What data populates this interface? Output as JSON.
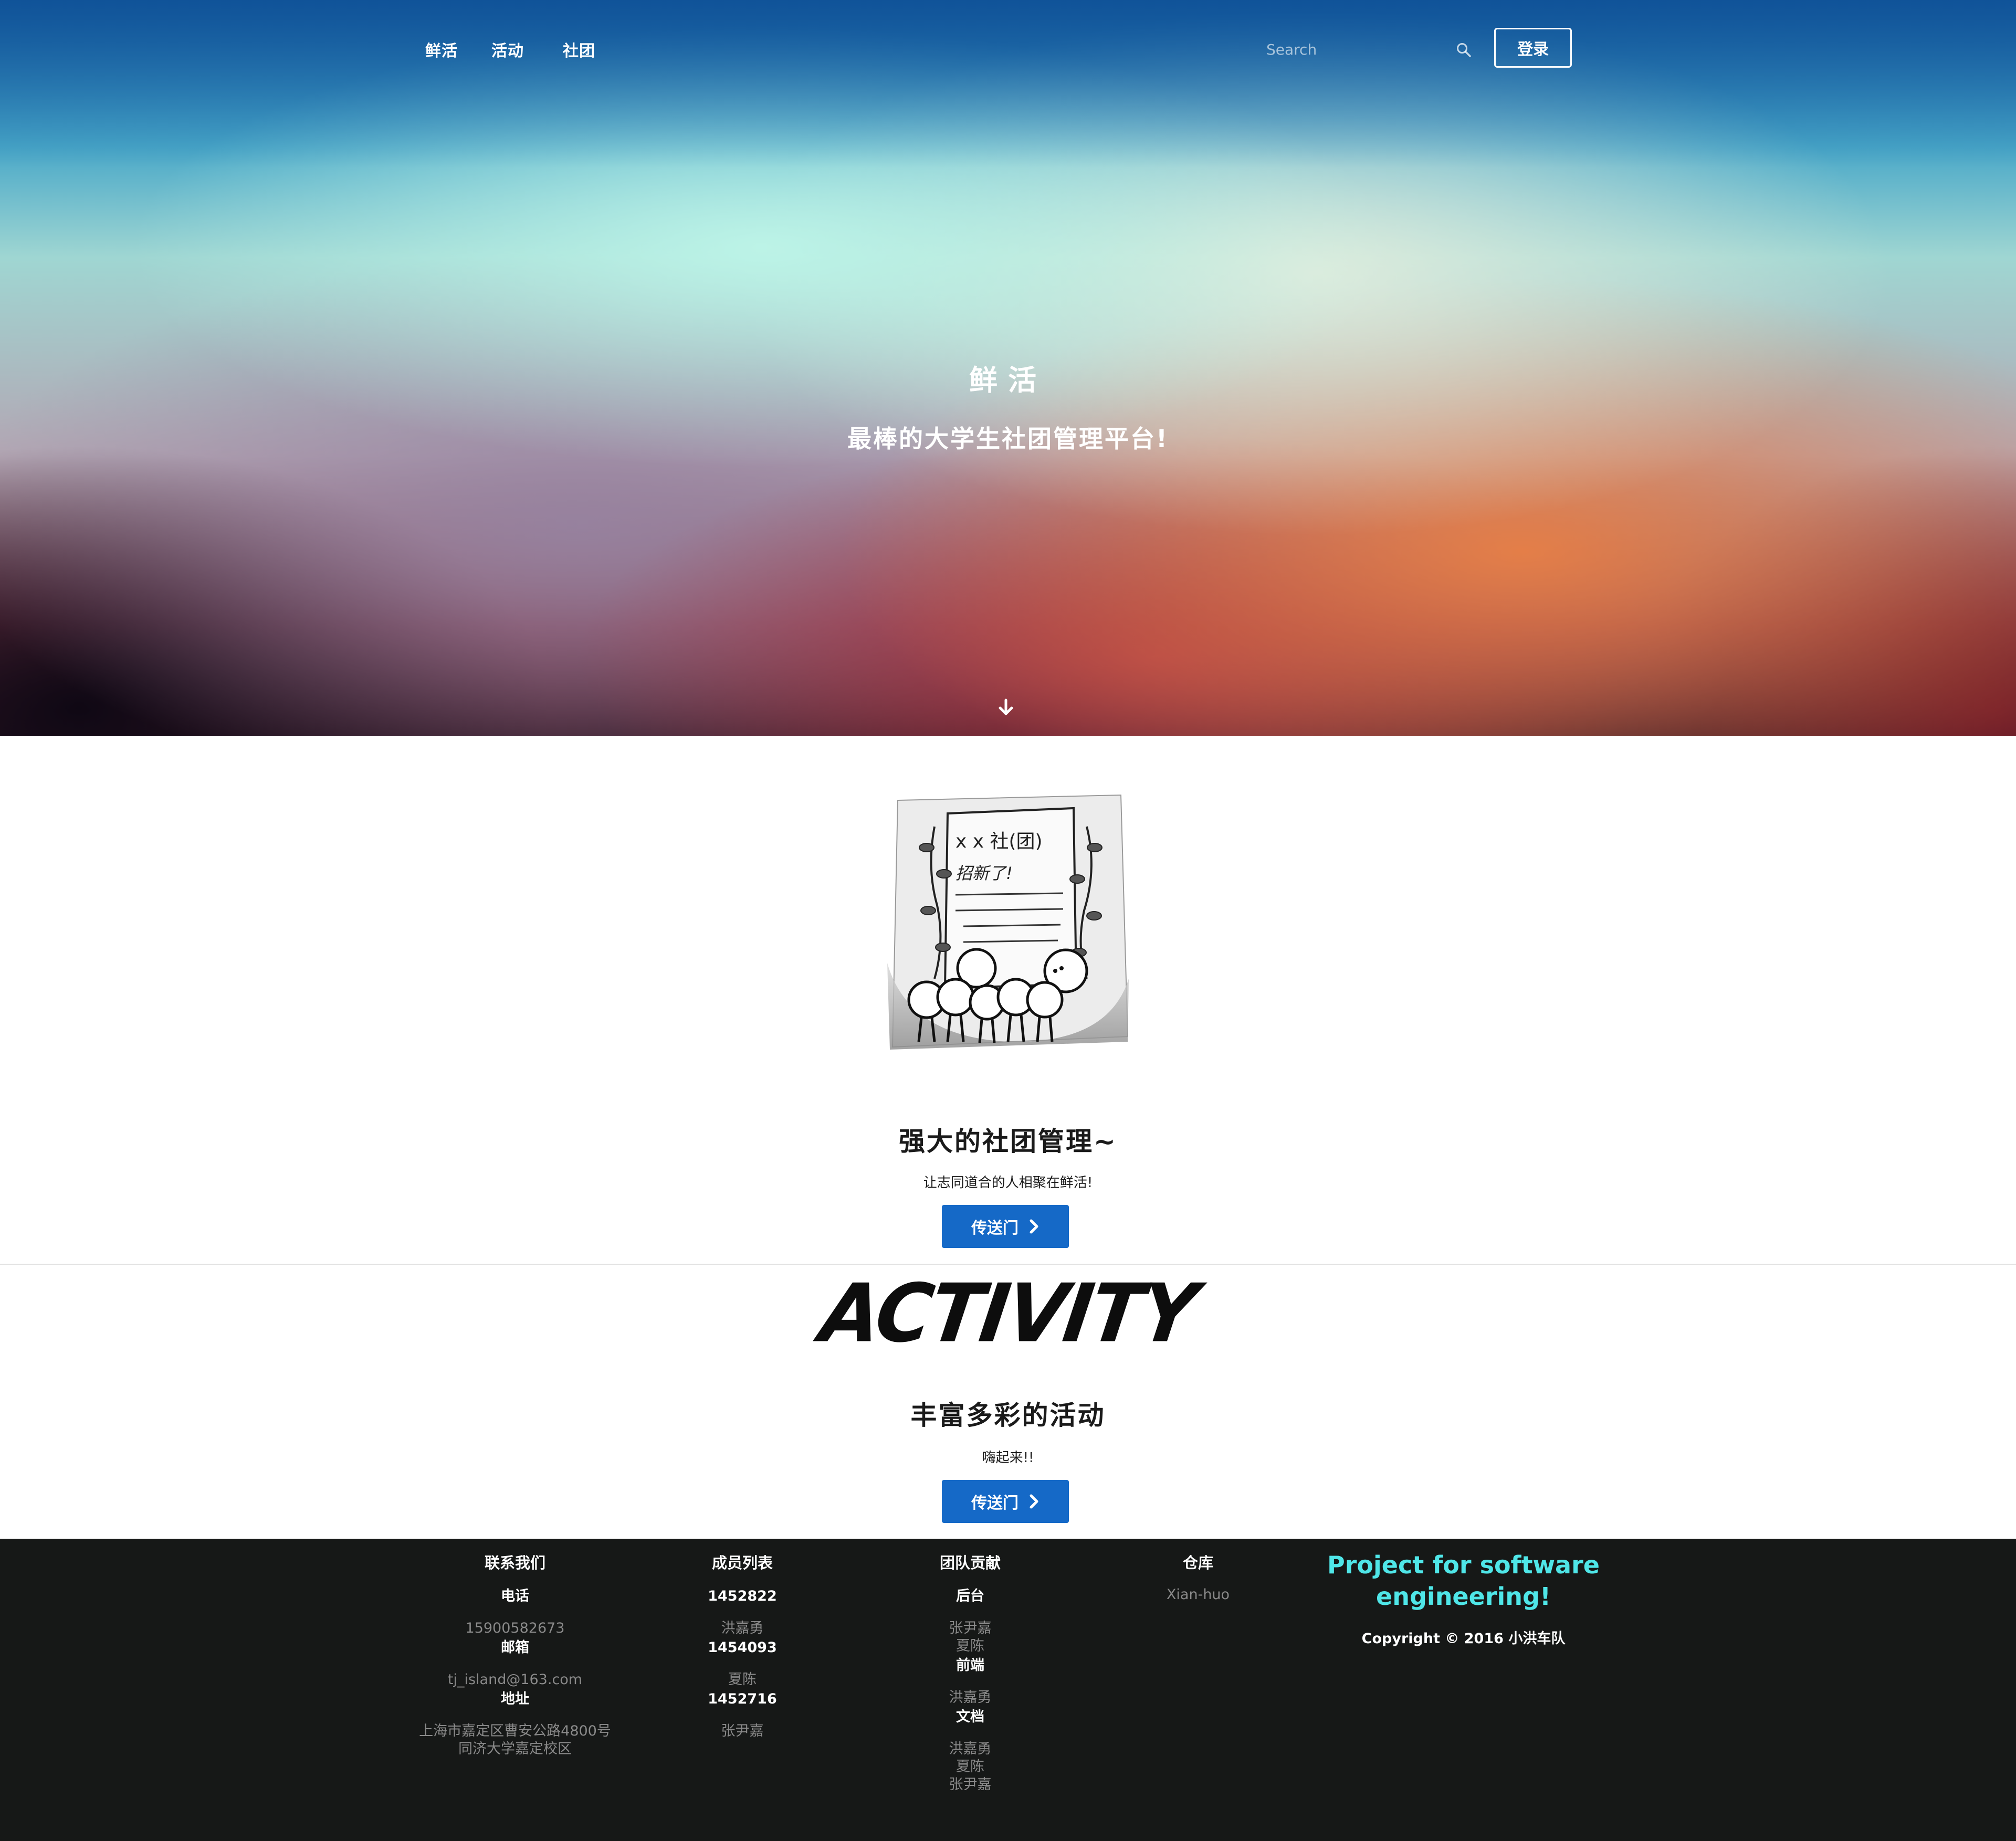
{
  "nav": {
    "links": [
      "鲜活",
      "活动",
      "社团"
    ],
    "search_placeholder": "Search",
    "login_label": "登录"
  },
  "hero": {
    "title": "鲜活",
    "subtitle": "最棒的大学生社团管理平台!"
  },
  "club_section": {
    "illustration_text": [
      "x x 社(团)",
      "招新了!"
    ],
    "title": "强大的社团管理~",
    "subtitle": "让志同道合的人相聚在鲜活!",
    "button_label": "传送门"
  },
  "activity_section": {
    "logo_text": "ACTIVITY",
    "title": "丰富多彩的活动",
    "subtitle": "嗨起来!!",
    "button_label": "传送门"
  },
  "footer": {
    "contact": {
      "heading": "联系我们",
      "phone_label": "电话",
      "phone": "15900582673",
      "email_label": "邮箱",
      "email": "tj_island@163.com",
      "address_label": "地址",
      "address_line1": "上海市嘉定区曹安公路4800号",
      "address_line2": "同济大学嘉定校区"
    },
    "members": {
      "heading": "成员列表",
      "list": [
        {
          "id": "1452822",
          "name": "洪嘉勇"
        },
        {
          "id": "1454093",
          "name": "夏陈"
        },
        {
          "id": "1452716",
          "name": "张尹嘉"
        }
      ]
    },
    "contribution": {
      "heading": "团队贡献",
      "groups": [
        {
          "role": "后台",
          "names": [
            "张尹嘉",
            "夏陈"
          ]
        },
        {
          "role": "前端",
          "names": [
            "洪嘉勇"
          ]
        },
        {
          "role": "文档",
          "names": [
            "洪嘉勇",
            "夏陈",
            "张尹嘉"
          ]
        }
      ]
    },
    "repo": {
      "heading": "仓库",
      "link": "Xian-huo"
    },
    "project": {
      "line1": "Project for software",
      "line2": "engineering!",
      "copyright": "Copyright © 2016 小洪车队"
    }
  },
  "colors": {
    "primary_button": "#1569c7",
    "footer_bg": "#161817",
    "project_title": "#4fe6e8"
  }
}
